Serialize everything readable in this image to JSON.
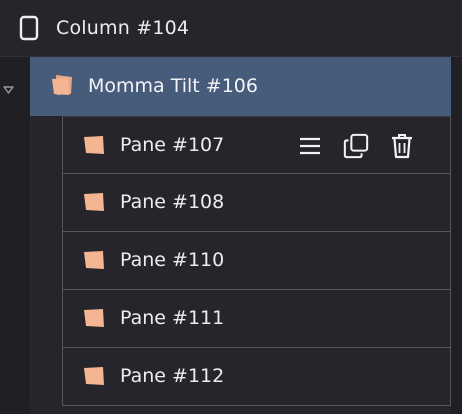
{
  "column": {
    "label": "Column #104",
    "icon": "mobile-device-icon"
  },
  "group": {
    "label": "Momma Tilt #106",
    "icon": "tilt-panes-icon",
    "expanded": true
  },
  "panes": [
    {
      "label": "Pane #107",
      "icon": "pane-icon",
      "hovered": true
    },
    {
      "label": "Pane #108",
      "icon": "pane-icon"
    },
    {
      "label": "Pane #110",
      "icon": "pane-icon"
    },
    {
      "label": "Pane #111",
      "icon": "pane-icon"
    },
    {
      "label": "Pane #112",
      "icon": "pane-icon"
    }
  ],
  "actions": {
    "menu_icon": "menu-icon",
    "duplicate_icon": "duplicate-icon",
    "delete_icon": "trash-icon"
  },
  "colors": {
    "background": "#25252b",
    "selected_row": "#475b7a",
    "pane_icon": "#f4b692",
    "row_border": "#55555e",
    "text": "#ececf1"
  }
}
